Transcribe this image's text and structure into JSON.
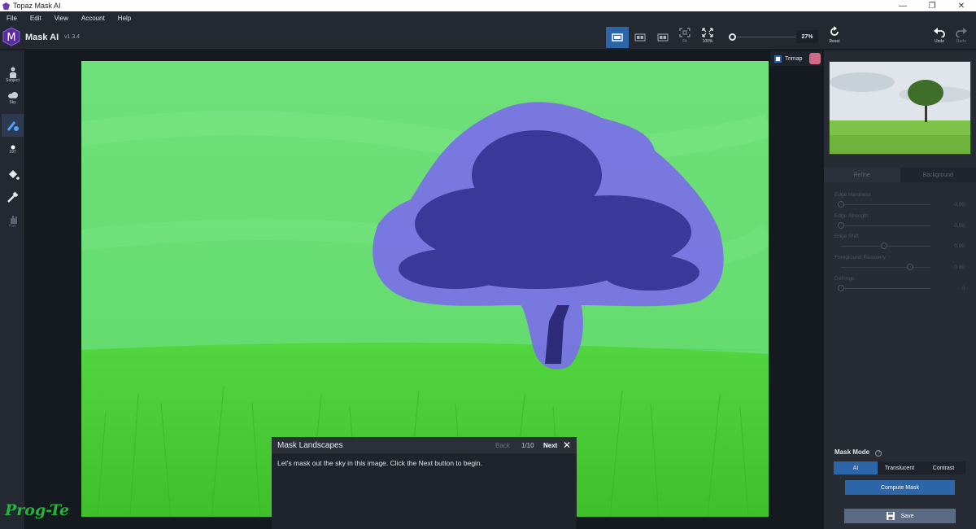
{
  "window": {
    "title": "Topaz Mask AI",
    "controls": [
      "—",
      "❐",
      "✕"
    ]
  },
  "menu": [
    "File",
    "Edit",
    "View",
    "Account",
    "Help"
  ],
  "app": {
    "name": "Mask AI",
    "version": "v1.3.4"
  },
  "toolbar": {
    "fit_label": "Fit",
    "hundred_label": "100%",
    "zoom_value": "27%",
    "reset_label": "Reset",
    "undo_label": "Undo",
    "redo_label": "Redo"
  },
  "tools": {
    "subject_label": "Subject",
    "sky_label": "Sky",
    "brush_size": "197",
    "pan_label": "Pan"
  },
  "trimap": {
    "label": "Trimap"
  },
  "panel": {
    "tabs": [
      "Refine",
      "Background"
    ],
    "sliders": [
      {
        "label": "Edge Hardness",
        "value": "0.00",
        "level": 0.0
      },
      {
        "label": "Edge Strength",
        "value": "0.00",
        "level": 0.0
      },
      {
        "label": "Edge Shift",
        "value": "0.00",
        "level": 0.5
      },
      {
        "label": "Foreground Recovery",
        "value": "0.80",
        "level": 0.8
      },
      {
        "label": "Defringe",
        "value": "0",
        "level": 0.0
      }
    ],
    "mask_mode_label": "Mask Mode",
    "mask_modes": [
      "AI",
      "Translucent",
      "Contrast"
    ],
    "compute_label": "Compute Mask",
    "save_label": "Save"
  },
  "tour": {
    "title": "Mask Landscapes",
    "back": "Back",
    "count": "1/10",
    "next": "Next",
    "close": "✕",
    "message": "Let's mask out the sky in this image. Click the Next button to begin."
  },
  "watermark": "Prog-Te"
}
